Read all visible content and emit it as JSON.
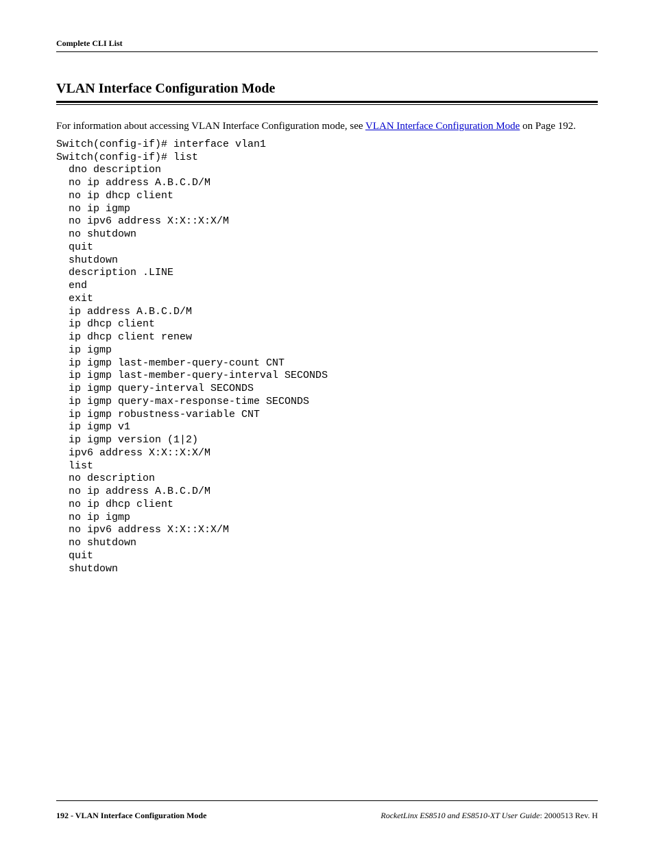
{
  "header": {
    "label": "Complete CLI List"
  },
  "section": {
    "title": "VLAN Interface Configuration Mode"
  },
  "intro": {
    "prefix": "For information about accessing VLAN Interface Configuration mode, see ",
    "link_text": "VLAN Interface Configuration Mode",
    "suffix": " on Page 192."
  },
  "code": "Switch(config-if)# interface vlan1\nSwitch(config-if)# list\n  dno description\n  no ip address A.B.C.D/M\n  no ip dhcp client\n  no ip igmp\n  no ipv6 address X:X::X:X/M\n  no shutdown\n  quit\n  shutdown\n  description .LINE\n  end\n  exit\n  ip address A.B.C.D/M\n  ip dhcp client\n  ip dhcp client renew\n  ip igmp\n  ip igmp last-member-query-count CNT\n  ip igmp last-member-query-interval SECONDS\n  ip igmp query-interval SECONDS\n  ip igmp query-max-response-time SECONDS\n  ip igmp robustness-variable CNT\n  ip igmp v1\n  ip igmp version (1|2)\n  ipv6 address X:X::X:X/M\n  list\n  no description\n  no ip address A.B.C.D/M\n  no ip dhcp client\n  no ip igmp\n  no ipv6 address X:X::X:X/M\n  no shutdown\n  quit\n  shutdown",
  "footer": {
    "page_number": "192",
    "section_name": "VLAN Interface Configuration Mode",
    "guide_name": "RocketLinx ES8510  and ES8510-XT User Guide",
    "revision": ": 2000513 Rev. H"
  }
}
